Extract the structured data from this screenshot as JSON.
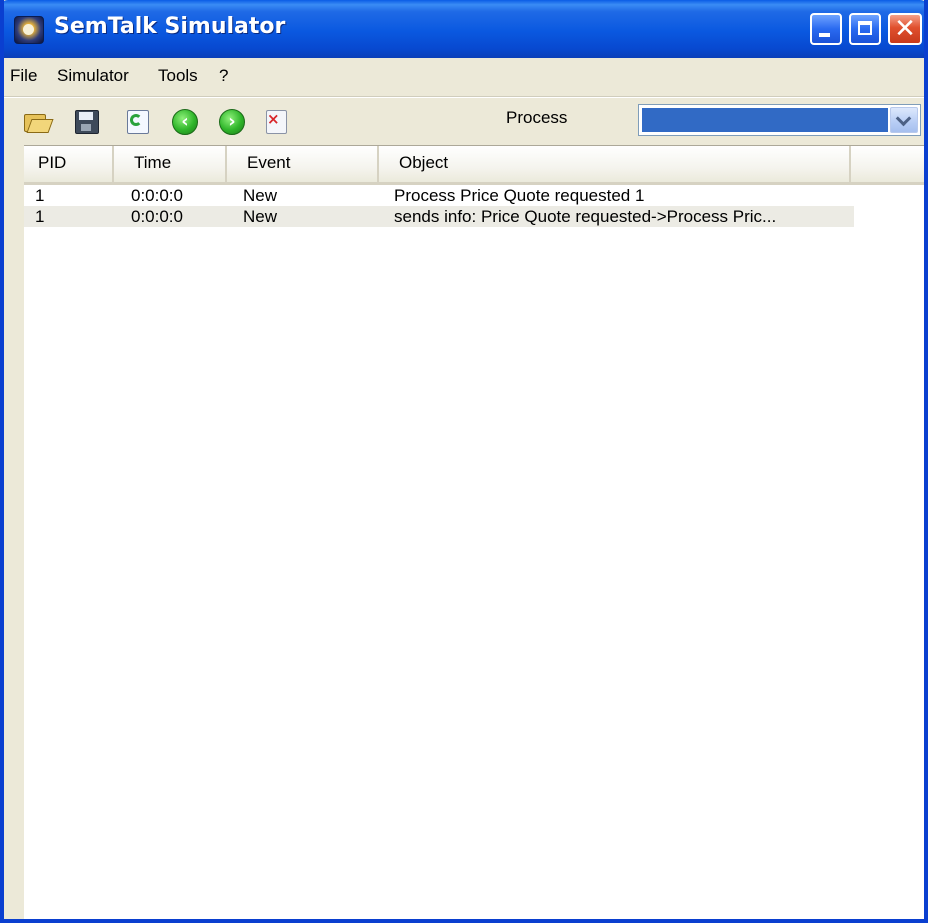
{
  "window": {
    "title": "SemTalk Simulator",
    "icon": "semtalk-app-icon",
    "controls": {
      "minimize": "minimize-icon",
      "maximize": "maximize-icon",
      "close": "close-icon",
      "close_glyph": "✕"
    }
  },
  "menubar": {
    "items": [
      "File",
      "Simulator",
      "Tools",
      "?"
    ]
  },
  "toolbar": {
    "icons": [
      "open-folder-icon",
      "save-disk-icon",
      "refresh-icon",
      "back-arrow-icon",
      "forward-arrow-icon",
      "stop-delete-icon"
    ],
    "back_glyph": "‹",
    "forward_glyph": "›",
    "stop_glyph": "×",
    "process_label": "Process",
    "process_value": "",
    "process_dropdown_icon": "chevron-down-icon"
  },
  "table": {
    "columns": [
      "PID",
      "Time",
      "Event",
      "Object"
    ],
    "rows": [
      {
        "pid": "1",
        "time": "0:0:0:0",
        "event": "New",
        "object": "Process Price Quote requested 1"
      },
      {
        "pid": "1",
        "time": "0:0:0:0",
        "event": "New",
        "object": "sends info: Price Quote requested->Process Pric..."
      }
    ]
  },
  "colors": {
    "titlebar": "#0a58e0",
    "window_frame": "#0a3fd0",
    "chrome": "#ece9d8",
    "selection": "#316ac5",
    "alt_row": "#ecebe4"
  }
}
